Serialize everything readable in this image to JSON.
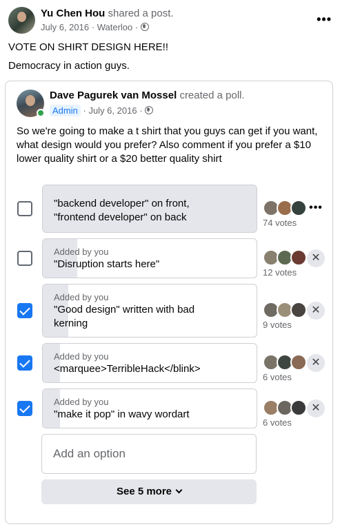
{
  "post": {
    "author": "Yu Chen Hou",
    "action": "shared a post.",
    "date": "July 6, 2016",
    "location": "Waterloo",
    "sep": "·",
    "more_icon": "more-horizontal-icon",
    "line1": "VOTE ON SHIRT DESIGN HERE!!",
    "line2": "Democracy in action guys."
  },
  "poll": {
    "author": "Dave Pagurek van Mossel",
    "action": "created a poll.",
    "badge": "Admin",
    "date": "July 6, 2016",
    "sep": "·",
    "question": "So we're going to make a t shirt that you guys can get if you want, what design would you prefer? Also comment if you prefer a $10 lower quality shirt or a $20 better quality shirt",
    "options": [
      {
        "line1": "\"backend developer\" on front,",
        "line2": "\"frontend developer\" on back",
        "added_by": "",
        "votes": "74 votes",
        "checked": false,
        "fill": 1.0
      },
      {
        "added_by": "Added by you",
        "line1": "\"Disruption starts here\"",
        "line2": "",
        "votes": "12 votes",
        "checked": false,
        "fill": 0.16
      },
      {
        "added_by": "Added by you",
        "line1": "\"Good design\" written with bad",
        "line2": "kerning",
        "votes": "9 votes",
        "checked": true,
        "fill": 0.12
      },
      {
        "added_by": "Added by you",
        "line1": "<marquee>TerribleHack</blink>",
        "line2": "",
        "votes": "6 votes",
        "checked": true,
        "fill": 0.08
      },
      {
        "added_by": "Added by you",
        "line1": "\"make it pop\" in wavy wordart",
        "line2": "",
        "votes": "6 votes",
        "checked": true,
        "fill": 0.08
      }
    ],
    "add_placeholder": "Add an option",
    "see_more": "See 5 more"
  },
  "colors": {
    "accent": "#1877f2",
    "online": "#31a24c",
    "secondary_text": "#65676b",
    "bar_fill": "#e4e6eb"
  }
}
